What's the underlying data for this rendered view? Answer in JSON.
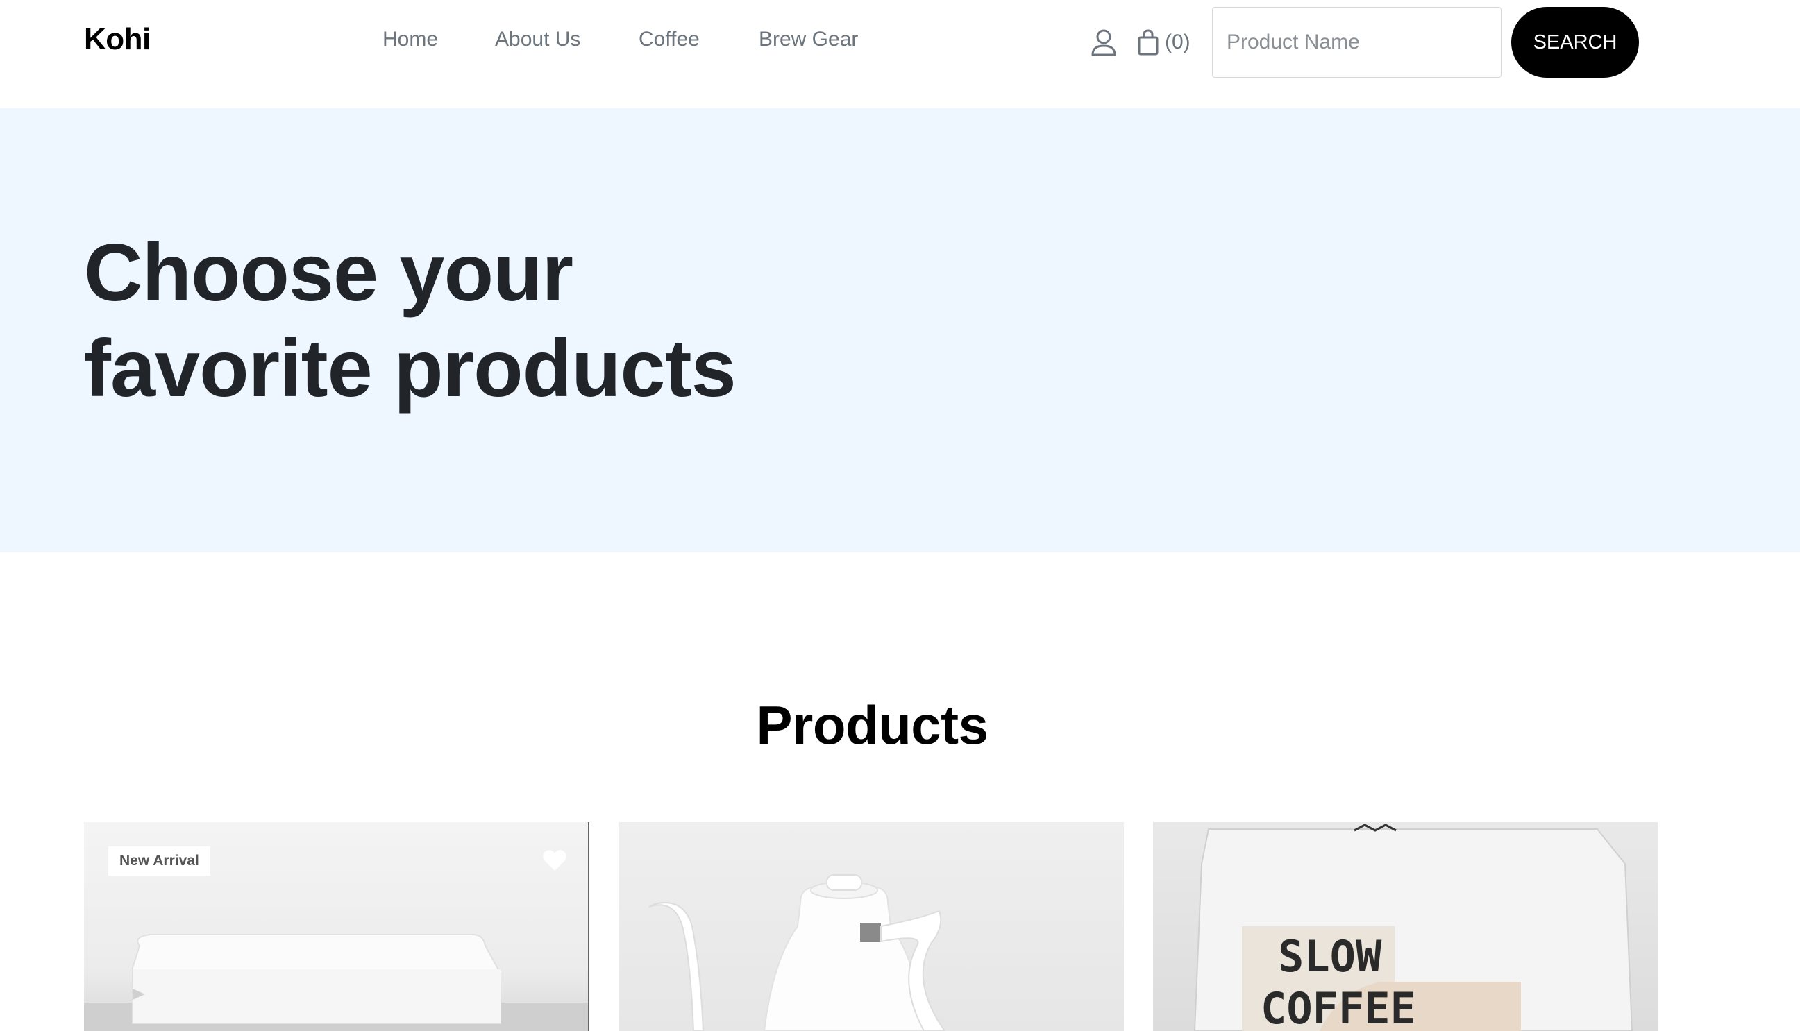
{
  "header": {
    "brand": "Kohi",
    "nav": [
      "Home",
      "About Us",
      "Coffee",
      "Brew Gear"
    ],
    "user_icon": "user-icon",
    "cart_icon": "shopping-bag-icon",
    "cart_count": "(0)",
    "search": {
      "placeholder": "Product Name",
      "value": ""
    },
    "search_button": "SEARCH"
  },
  "hero": {
    "title_line1": "Choose your",
    "title_line2": "favorite products",
    "background": "#eef6ff"
  },
  "products": {
    "heading": "Products",
    "cards": [
      {
        "badge": "New Arrival",
        "wishlist_icon": "heart-icon",
        "image": "coffee-scale"
      },
      {
        "image": "pour-over-kettle"
      },
      {
        "image": "coffee-filters-bag",
        "package_text_1": "SLOW",
        "package_text_2": "COFFEE"
      }
    ]
  },
  "colors": {
    "accent": "#000000",
    "nav_text": "#6c757d",
    "hero_text": "#212529"
  }
}
